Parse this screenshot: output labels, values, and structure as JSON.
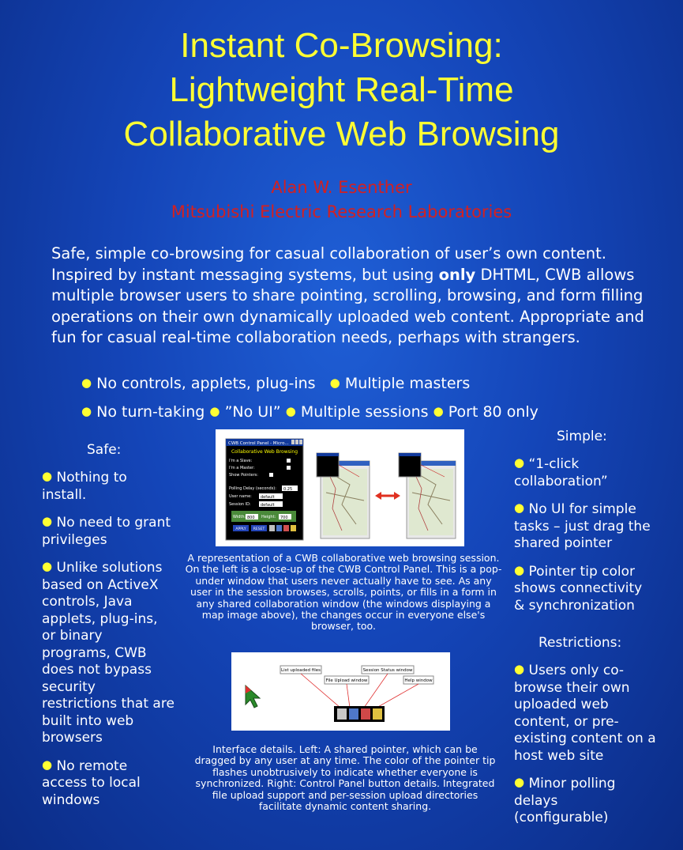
{
  "title": {
    "line1": "Instant Co-Browsing:",
    "line2": "Lightweight Real-Time",
    "line3": "Collaborative Web Browsing"
  },
  "author": {
    "name": "Alan W. Esenther",
    "org": "Mitsubishi Electric Research Laboratories"
  },
  "abstract": {
    "part1": "Safe, simple co-browsing for casual collaboration of user’s own content. Inspired by instant messaging systems, but using ",
    "emphasis": "only",
    "part2": " DHTML, CWB allows multiple browser users to share pointing, scrolling, browsing, and form filling operations on their own dynamically uploaded web content. Appropriate and fun for casual real-time collaboration needs, perhaps with strangers."
  },
  "features": {
    "row1": [
      "No controls, applets, plug-ins",
      "Multiple masters"
    ],
    "row2": [
      "No turn-taking",
      "”No UI”",
      "Multiple sessions",
      "Port 80 only"
    ]
  },
  "safe": {
    "heading": "Safe:",
    "items": [
      "Nothing to install.",
      "No need to grant privileges",
      "Unlike solutions based on ActiveX controls, Java applets, plug-ins, or binary programs, CWB does not bypass security restrictions that are built into web browsers",
      "No remote access to local windows"
    ]
  },
  "simple": {
    "heading": "Simple:",
    "items": [
      "“1-click collaboration”",
      "No UI for simple tasks – just drag the shared pointer",
      "Pointer tip color shows connectivity & synchronization"
    ]
  },
  "restrictions": {
    "heading": "Restrictions:",
    "items": [
      "Users only co-browse their own uploaded web content, or pre-existing content on a host web site",
      "Minor polling delays (configurable)"
    ]
  },
  "figure1": {
    "caption": "A representation of a CWB collaborative web browsing session. On the left is a close-up of the CWB Control Panel. This is a pop-under window that users never actually have to see. As any user in the session browses, scrolls, points, or fills in a form in any shared collaboration window (the windows displaying a map image above), the changes occur in everyone else's browser, too.",
    "panel": {
      "window_title": "CWB Control Panel - Micro...",
      "heading": "Collaborative Web Browsing",
      "slave_label": "I'm a Slave:",
      "master_label": "I'm a Master:",
      "show_pointers_label": "Show Pointers:",
      "polling_label": "Polling Delay (seconds):",
      "polling_value": "0.25",
      "user_label": "User name:",
      "user_value": "default",
      "session_label": "Session ID:",
      "session_value": "default",
      "width_label": "Width:",
      "width_value": "800",
      "height_label": "Height:",
      "height_value": "700",
      "apply_label": "APPLY",
      "reset_label": "RESET"
    }
  },
  "figure2": {
    "caption": "Interface details. Left: A shared pointer, which can be dragged by any user at any time. The color of the pointer tip flashes unobtrusively to indicate whether everyone is synchronized. Right: Control Panel button details. Integrated file upload support and per-session upload directories facilitate dynamic content sharing.",
    "labels": {
      "list": "List uploaded files",
      "upload": "File Upload window",
      "status": "Session Status window",
      "help": "Help window"
    }
  },
  "colors": {
    "title": "#ffff33",
    "author": "#d42020",
    "bullet": "#ffff33"
  }
}
